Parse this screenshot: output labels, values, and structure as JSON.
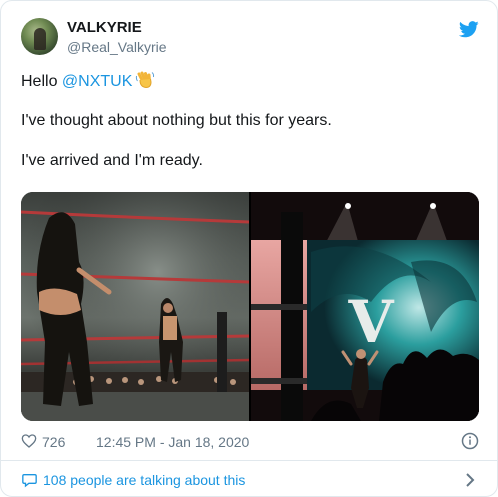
{
  "author": {
    "display_name": "VALKYRIE",
    "handle": "@Real_Valkyrie"
  },
  "tweet": {
    "greeting": "Hello ",
    "mention": "@NXTUK",
    "line2": "I've thought about nothing but this for years.",
    "line3": "I've arrived and I'm ready."
  },
  "media": {
    "count": 2,
    "overlay_letter": "V"
  },
  "meta": {
    "likes": "726",
    "timestamp": "12:45 PM - Jan 18, 2020"
  },
  "conversation": {
    "label": "108 people are talking about this"
  },
  "icons": {
    "brand": "twitter-bird-icon",
    "emoji": "waving-hand-icon",
    "like": "heart-icon",
    "info": "info-icon",
    "conversation": "speech-bubble-icon",
    "open": "chevron-right-icon"
  },
  "colors": {
    "link": "#1b95e0",
    "muted": "#657786",
    "text": "#14171a",
    "border": "#e1e8ed",
    "brand": "#1da1f2"
  }
}
